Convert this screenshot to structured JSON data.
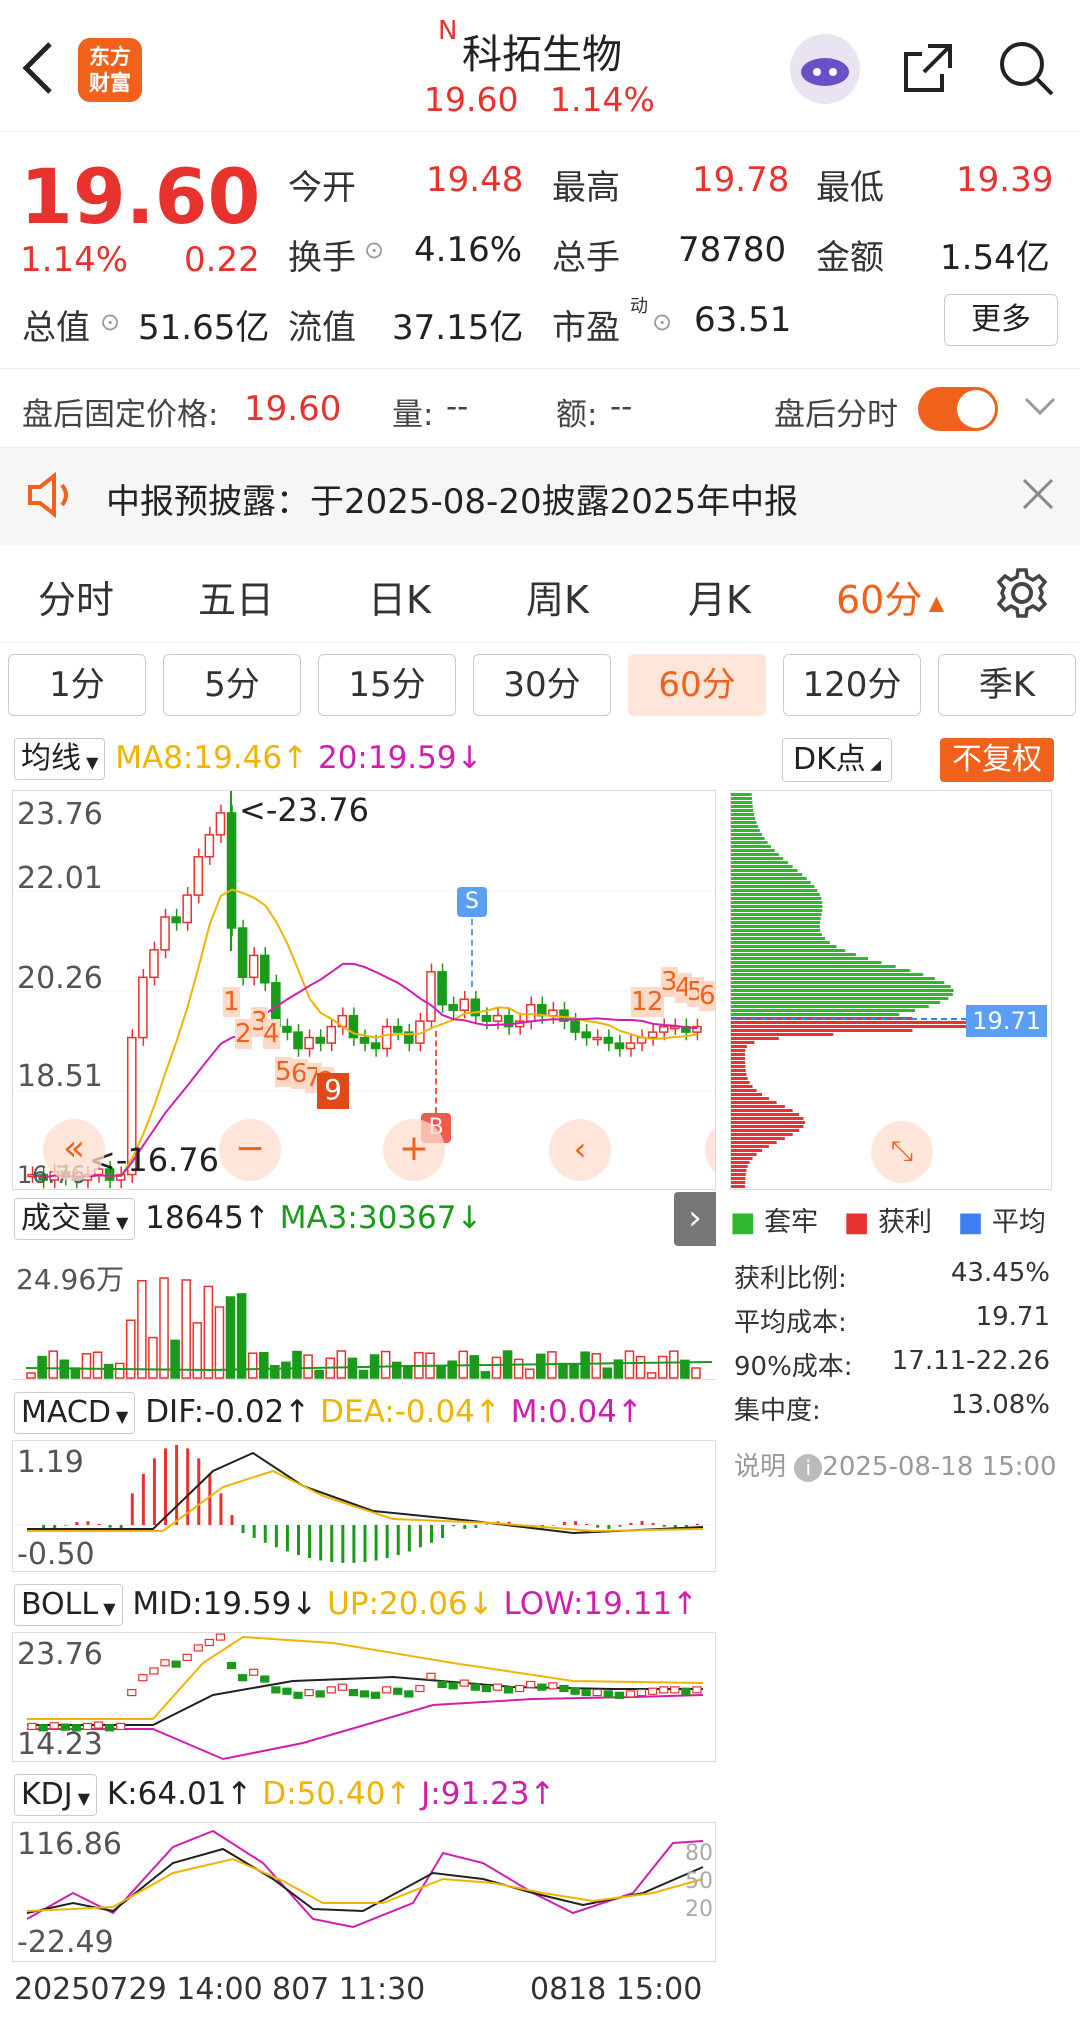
{
  "header": {
    "logo_text_1": "东方",
    "logo_text_2": "财富",
    "badge": "N",
    "title": "科拓生物",
    "price": "19.60",
    "change_pct": "1.14%"
  },
  "quote": {
    "price": "19.60",
    "change_pct": "1.14%",
    "change": "0.22",
    "open_label": "今开",
    "open": "19.48",
    "high_label": "最高",
    "high": "19.78",
    "low_label": "最低",
    "low": "19.39",
    "turnover_label": "换手",
    "turnover": "4.16%",
    "volume_label": "总手",
    "volume": "78780",
    "amount_label": "金额",
    "amount": "1.54亿",
    "mcap_label": "总值",
    "mcap": "51.65亿",
    "float_label": "流值",
    "float": "37.15亿",
    "pe_label": "市盈",
    "pe_sup": "动",
    "pe": "63.51",
    "more_label": "更多"
  },
  "after_hours": {
    "label": "盘后固定价格:",
    "price": "19.60",
    "vol_label": "量:",
    "vol": "--",
    "amt_label": "额:",
    "amt": "--",
    "toggle_label": "盘后分时"
  },
  "banner": {
    "text": "中报预披露：于2025-08-20披露2025年中报"
  },
  "tabs": [
    "分时",
    "五日",
    "日K",
    "周K",
    "月K",
    "60分"
  ],
  "periods": [
    "1分",
    "5分",
    "15分",
    "30分",
    "60分",
    "120分",
    "季K"
  ],
  "ma": {
    "selector": "均线",
    "ma8": "MA8:19.46",
    "ma8_arrow": "↑",
    "ma20": "20:19.59",
    "ma20_arrow": "↓",
    "dk": "DK点",
    "restore": "不复权"
  },
  "kline": {
    "y_labels": [
      "23.76",
      "22.01",
      "20.26",
      "18.51",
      "16.76"
    ],
    "max_marker": "<-23.76",
    "min_marker": "<-16.76",
    "signal_s": "S",
    "signal_b": "B",
    "nums": [
      "1",
      "2",
      "3",
      "4",
      "5",
      "6",
      "7",
      "8",
      "9",
      "1",
      "2",
      "3",
      "4",
      "5",
      "6"
    ]
  },
  "volume": {
    "selector": "成交量",
    "value": "18645",
    "arrow": "↑",
    "ma3": "MA3:30367",
    "ma3_arrow": "↓",
    "y_label": "24.96万"
  },
  "macd": {
    "selector": "MACD",
    "dif": "DIF:-0.02",
    "dif_arrow": "↑",
    "dea": "DEA:-0.04",
    "dea_arrow": "↑",
    "m": "M:0.04",
    "m_arrow": "↑",
    "y_top": "1.19",
    "y_bot": "-0.50"
  },
  "boll": {
    "selector": "BOLL",
    "mid": "MID:19.59",
    "mid_arrow": "↓",
    "up": "UP:20.06",
    "up_arrow": "↓",
    "low": "LOW:19.11",
    "low_arrow": "↑",
    "y_top": "23.76",
    "y_bot": "14.23"
  },
  "kdj": {
    "selector": "KDJ",
    "k": "K:64.01",
    "k_arrow": "↑",
    "d": "D:50.40",
    "d_arrow": "↑",
    "j": "J:91.23",
    "j_arrow": "↑",
    "y_top": "116.86",
    "y_bot": "-22.49",
    "r80": "80",
    "r50": "50",
    "r20": "20"
  },
  "x_axis": {
    "start": "20250729 14:00",
    "mid": "807 11:30",
    "end": "0818 15:00"
  },
  "chip": {
    "price_tag": "19.71",
    "legend_trapped": "套牢",
    "legend_profit": "获利",
    "legend_avg": "平均",
    "profit_ratio_label": "获利比例:",
    "profit_ratio": "43.45%",
    "avg_cost_label": "平均成本:",
    "avg_cost": "19.71",
    "cost90_label": "90%成本:",
    "cost90": "17.11-22.26",
    "concentration_label": "集中度:",
    "concentration": "13.08%",
    "note_label": "说明",
    "note_time": "2025-08-18 15:00"
  },
  "colors": {
    "up": "#e8322e",
    "down": "#1a9a1a",
    "accent": "#f0621c",
    "ma8": "#f0b400",
    "ma20": "#d11eb1"
  }
}
